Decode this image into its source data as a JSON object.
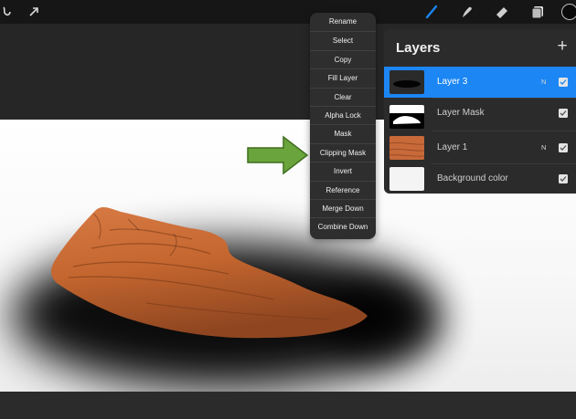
{
  "toolbar": {
    "left_icons": [
      "wrench-adjust-icon",
      "selection-arrow-icon"
    ],
    "right_icons": [
      "brush-icon",
      "smudge-icon",
      "eraser-icon",
      "layers-icon"
    ],
    "active_tool": "brush",
    "accent_color": "#1b86f4",
    "current_color": "#0a0a0a"
  },
  "context_menu": {
    "items": [
      "Rename",
      "Select",
      "Copy",
      "Fill Layer",
      "Clear",
      "Alpha Lock",
      "Mask",
      "Clipping Mask",
      "Invert",
      "Reference",
      "Merge Down",
      "Combine Down"
    ]
  },
  "annotation": {
    "arrow_color": "#6aa43c",
    "points_to": "Clipping Mask"
  },
  "layers_panel": {
    "title": "Layers",
    "add_icon": "plus-icon",
    "layers": [
      {
        "name": "Layer 3",
        "mode": "N",
        "visible": true,
        "selected": true
      },
      {
        "name": "Layer Mask",
        "mode": "",
        "visible": true,
        "selected": false
      },
      {
        "name": "Layer 1",
        "mode": "N",
        "visible": true,
        "selected": false
      },
      {
        "name": "Background color",
        "mode": "",
        "visible": true,
        "selected": false
      }
    ]
  }
}
